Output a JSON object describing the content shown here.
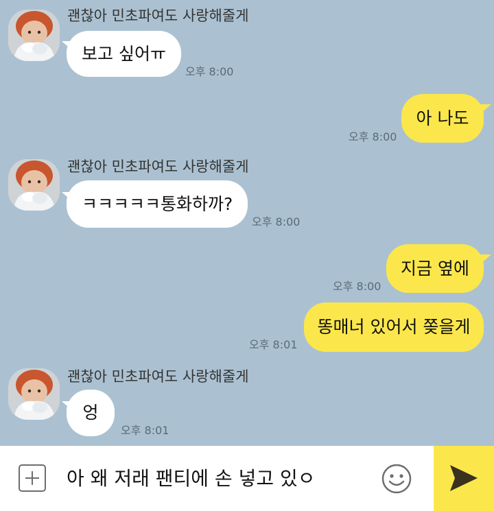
{
  "messages": [
    {
      "sender": "괜찮아 민초파여도 사랑해줄게",
      "text": "보고 싶어ㅠ",
      "time": "오후 8:00"
    },
    {
      "text": "아 나도",
      "time": "오후 8:00"
    },
    {
      "sender": "괜찮아 민초파여도 사랑해줄게",
      "text": "ㅋㅋㅋㅋㅋ통화하까?",
      "time": "오후 8:00"
    },
    {
      "text": "지금 옆에",
      "time": "오후 8:00"
    },
    {
      "text": "똥매너 있어서 쫒을게",
      "time": "오후 8:01"
    },
    {
      "sender": "괜찮아 민초파여도 사랑해줄게",
      "text": "엉",
      "time": "오후 8:01"
    }
  ],
  "composer": {
    "text": "아 왜 저래 팬티에 손 넣고 있ㅇ"
  },
  "colors": {
    "background": "#abc1d1",
    "incoming_bubble": "#ffffff",
    "outgoing_bubble": "#fbe74b",
    "send_button": "#fbe74b"
  },
  "icons": {
    "attach": "plus-icon",
    "emoji": "emoji-icon",
    "send": "send-icon"
  }
}
